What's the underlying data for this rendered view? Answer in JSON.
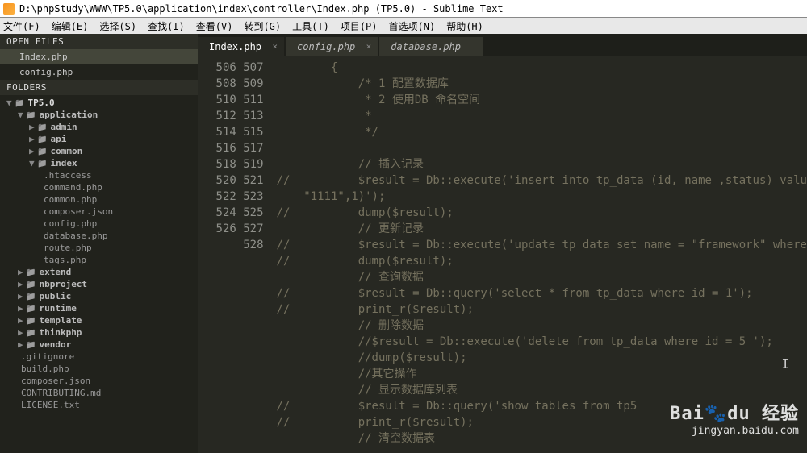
{
  "title": "D:\\phpStudy\\WWW\\TP5.0\\application\\index\\controller\\Index.php (TP5.0) - Sublime Text",
  "menu": [
    "文件(F)",
    "编辑(E)",
    "选择(S)",
    "查找(I)",
    "查看(V)",
    "转到(G)",
    "工具(T)",
    "项目(P)",
    "首选项(N)",
    "帮助(H)"
  ],
  "sidebar": {
    "open_label": "OPEN FILES",
    "open_files": [
      "Index.php",
      "config.php"
    ],
    "folders_label": "FOLDERS",
    "root": "TP5.0",
    "app": "application",
    "app_children": [
      "admin",
      "api",
      "common"
    ],
    "index": "index",
    "index_files": [
      ".htaccess",
      "command.php",
      "common.php",
      "composer.json",
      "config.php",
      "database.php",
      "route.php",
      "tags.php"
    ],
    "folders2": [
      "extend",
      "nbproject",
      "public",
      "runtime",
      "template",
      "thinkphp",
      "vendor"
    ],
    "root_files": [
      ".gitignore",
      "build.php",
      "composer.json",
      "CONTRIBUTING.md",
      "LICENSE.txt"
    ]
  },
  "tabs": [
    {
      "label": "Index.php",
      "close": "×",
      "active": true
    },
    {
      "label": "config.php",
      "close": "×",
      "active": false
    },
    {
      "label": "database.php",
      "close": "",
      "active": false
    }
  ],
  "code": {
    "start": 506,
    "lines": [
      "        {",
      "            /* 1 配置数据库",
      "             * 2 使用DB 命名空间",
      "             *",
      "             */",
      "",
      "            // 插入记录",
      "//          $result = Db::execute('insert into tp_data (id, name ,status) valu",
      "    \"1111\",1)');",
      "//          dump($result);",
      "            // 更新记录",
      "//          $result = Db::execute('update tp_data set name = \"framework\" where",
      "//          dump($result);",
      "            // 查询数据",
      "//          $result = Db::query('select * from tp_data where id = 1');",
      "//          print_r($result);",
      "            // 删除数据",
      "            //$result = Db::execute('delete from tp_data where id = 5 ');",
      "            //dump($result);",
      "            //其它操作",
      "            // 显示数据库列表",
      "//          $result = Db::query('show tables from tp5",
      "//          print_r($result);",
      "            // 清空数据表"
    ]
  },
  "watermark": {
    "logo": "Bai🐾du 经验",
    "url": "jingyan.baidu.com"
  }
}
